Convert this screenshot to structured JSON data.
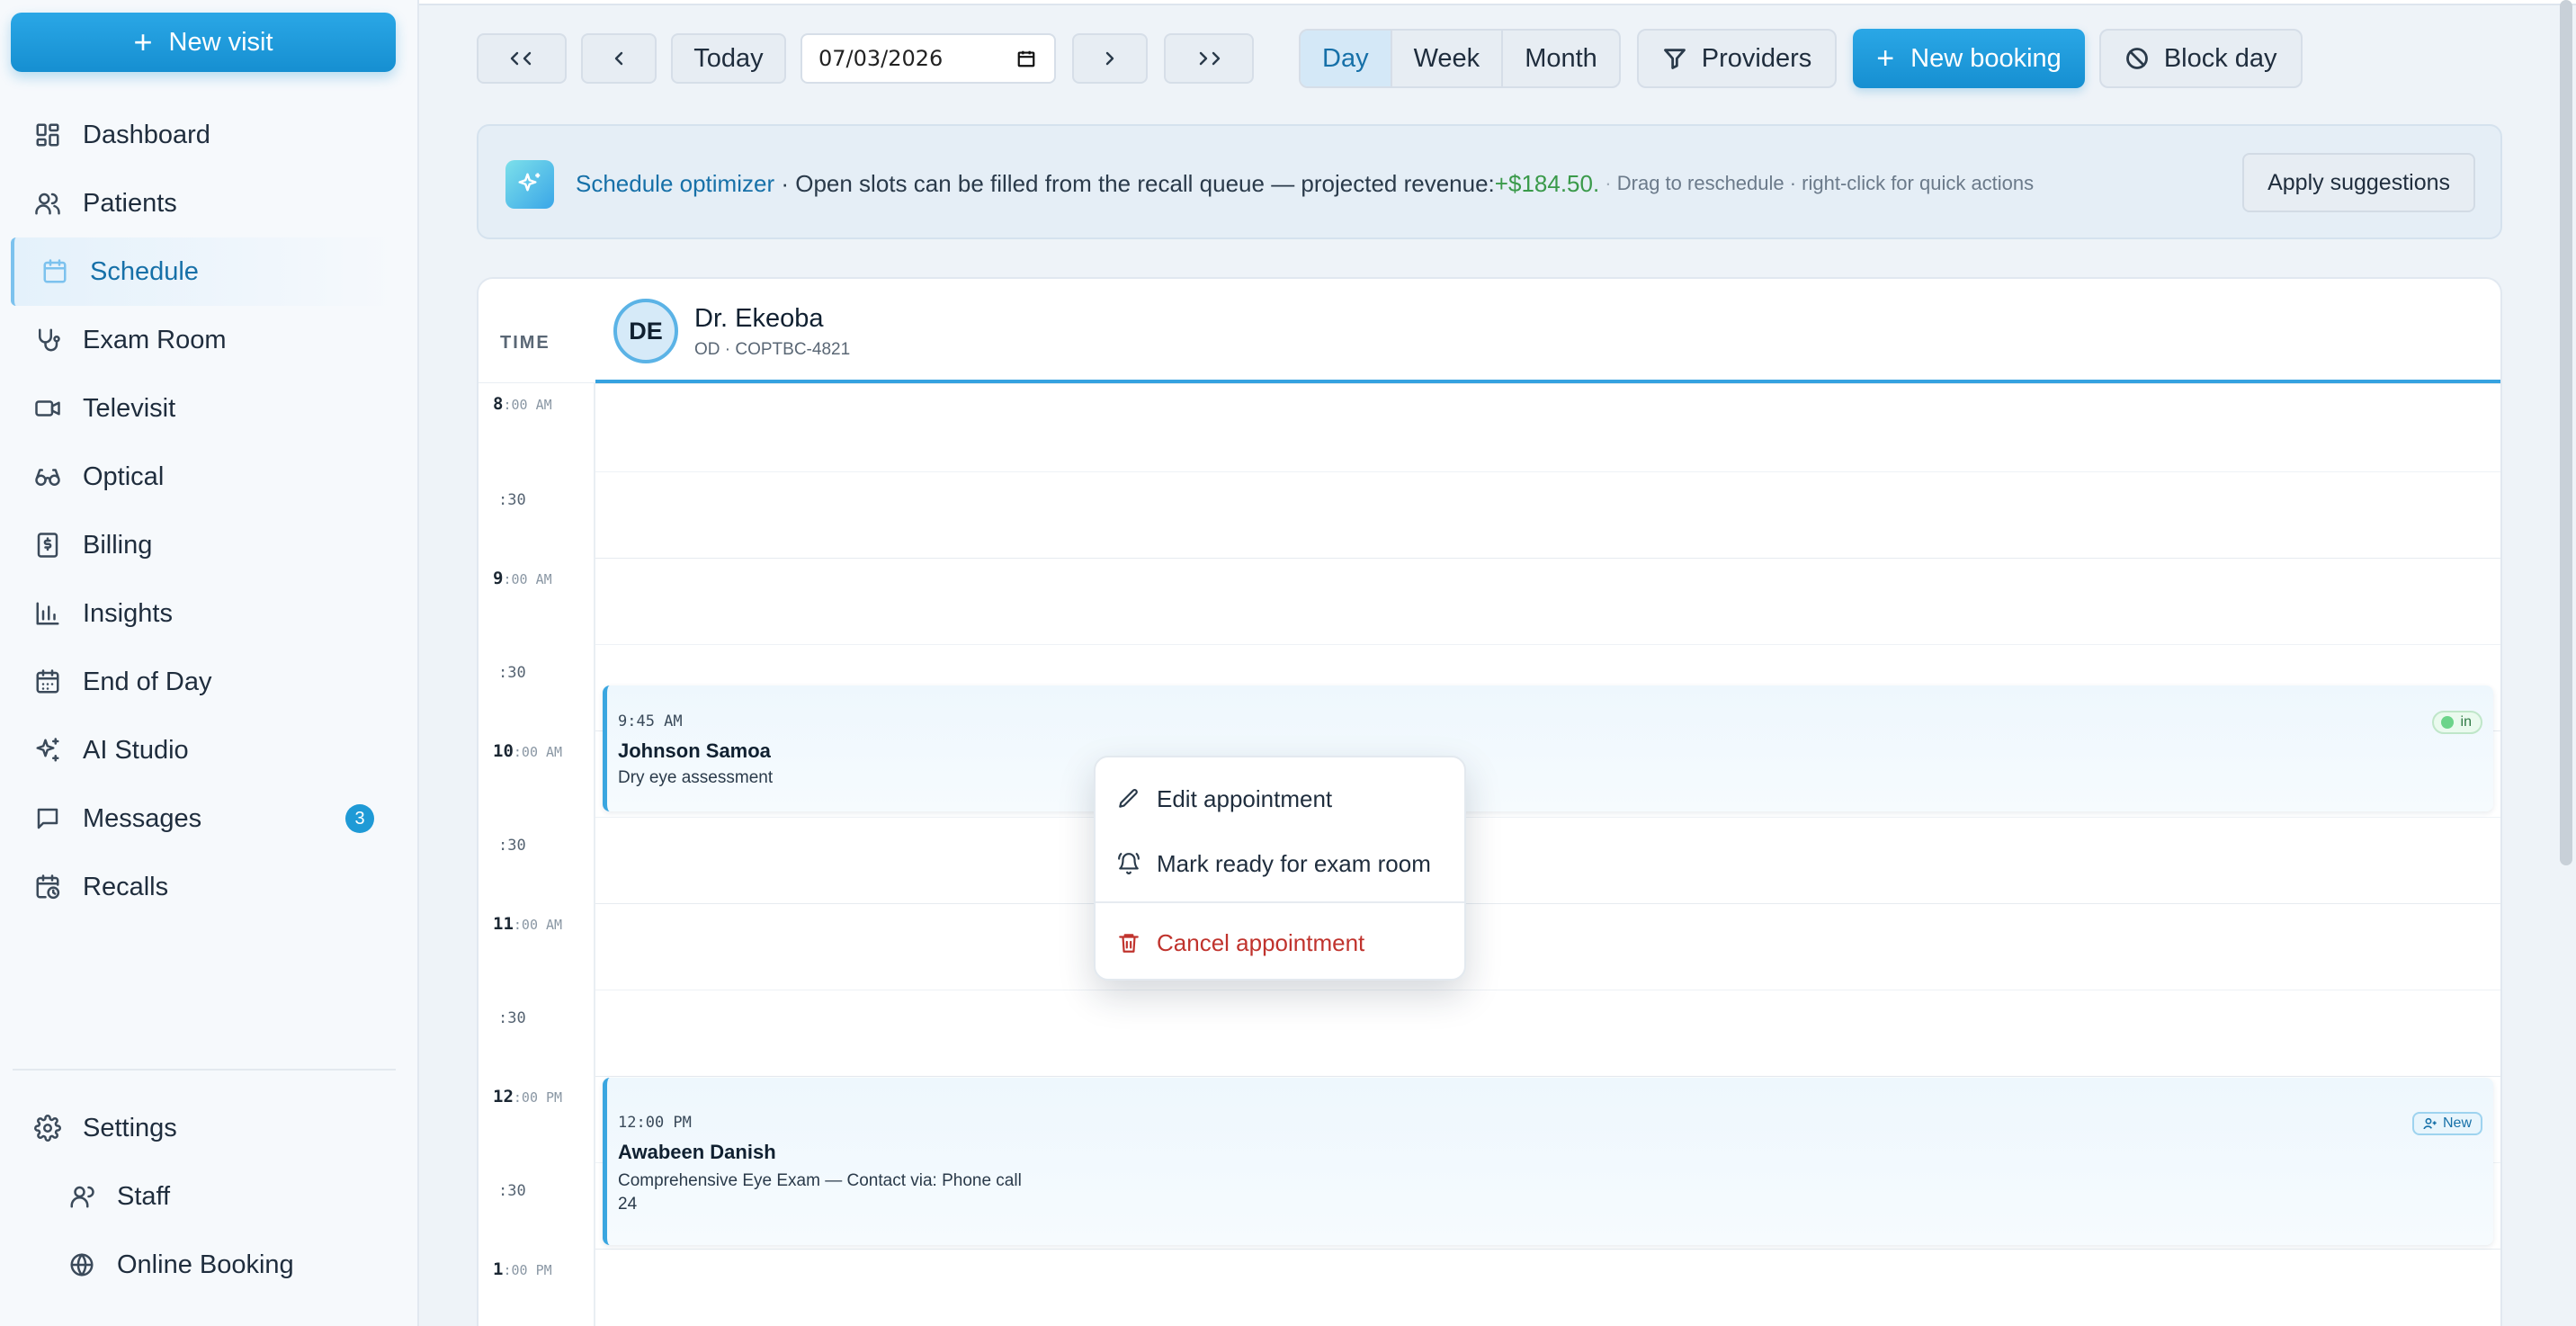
{
  "sidebar": {
    "new_visit": "New visit",
    "items": [
      {
        "label": "Dashboard",
        "icon": "dashboard-icon"
      },
      {
        "label": "Patients",
        "icon": "users-icon"
      },
      {
        "label": "Schedule",
        "icon": "calendar-icon"
      },
      {
        "label": "Exam Room",
        "icon": "stethoscope-icon"
      },
      {
        "label": "Televisit",
        "icon": "video-icon"
      },
      {
        "label": "Optical",
        "icon": "glasses-icon"
      },
      {
        "label": "Billing",
        "icon": "receipt-dollar-icon"
      },
      {
        "label": "Insights",
        "icon": "bar-chart-icon"
      },
      {
        "label": "End of Day",
        "icon": "calendar-check-icon"
      },
      {
        "label": "AI Studio",
        "icon": "sparkles-icon"
      },
      {
        "label": "Messages",
        "icon": "message-icon",
        "badge": "3"
      },
      {
        "label": "Recalls",
        "icon": "calendar-clock-icon"
      }
    ],
    "settings": "Settings",
    "staff": "Staff",
    "online_booking": "Online Booking"
  },
  "toolbar": {
    "date_value": "07/03/2026",
    "today": "Today",
    "views": [
      "Day",
      "Week",
      "Month"
    ],
    "active_view": "Day",
    "providers": "Providers",
    "new_booking": "New booking",
    "block_day": "Block day"
  },
  "banner": {
    "title": "Schedule optimizer",
    "sep": " · ",
    "message": "Open slots can be filled from the recall queue — projected revenue: ",
    "revenue": "+$184.50.",
    "hint_sep": " · ",
    "hint": "Drag to reschedule · right-click for quick actions",
    "apply": "Apply suggestions"
  },
  "calendar": {
    "time_header": "TIME",
    "provider": {
      "initials": "DE",
      "name": "Dr. Ekeoba",
      "subtitle": "OD · COPTBC-4821"
    },
    "slots": [
      {
        "hour": "8",
        "suffix": ":00 AM"
      },
      {
        "half": ":30"
      },
      {
        "hour": "9",
        "suffix": ":00 AM"
      },
      {
        "half": ":30"
      },
      {
        "hour": "10",
        "suffix": ":00 AM"
      },
      {
        "half": ":30"
      },
      {
        "hour": "11",
        "suffix": ":00 AM"
      },
      {
        "half": ":30"
      },
      {
        "hour": "12",
        "suffix": ":00 PM"
      },
      {
        "half": ":30"
      },
      {
        "hour": "1",
        "suffix": ":00 PM"
      }
    ],
    "appointments": [
      {
        "time": "9:45 AM",
        "name": "Johnson Samoa",
        "desc": "Dry eye assessment",
        "status": "in"
      },
      {
        "time": "12:00 PM",
        "name": "Awabeen Danish",
        "desc": "Comprehensive Eye Exam — Contact via: Phone call",
        "extra": "24",
        "tag": "New"
      }
    ]
  },
  "context_menu": {
    "edit": "Edit appointment",
    "ready": "Mark ready for exam room",
    "cancel": "Cancel appointment"
  },
  "colors": {
    "accent": "#1f9ad6",
    "danger": "#c0332d",
    "success": "#3a9a4a"
  }
}
